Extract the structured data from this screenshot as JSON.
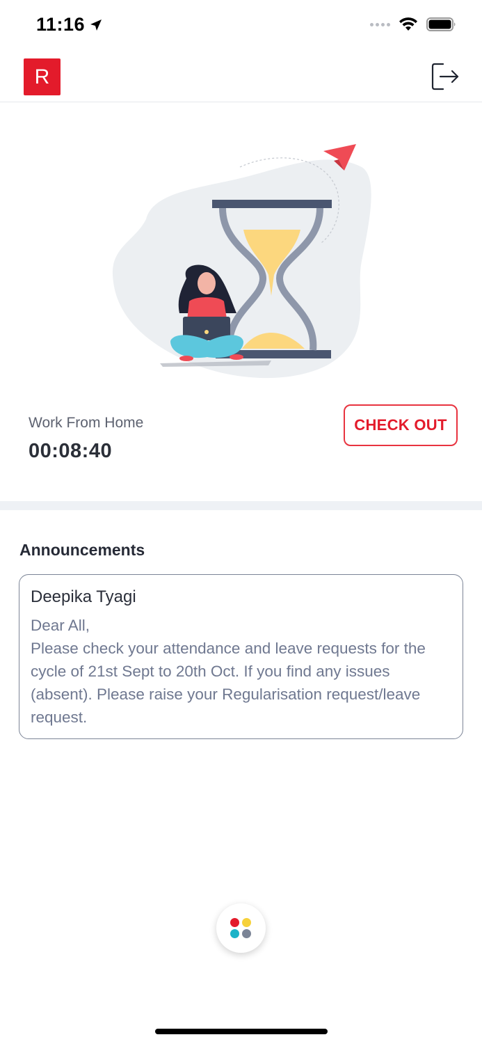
{
  "status_bar": {
    "time": "11:16",
    "icons": [
      "location-arrow-icon",
      "signal-icon",
      "wifi-icon",
      "battery-icon"
    ]
  },
  "header": {
    "logo_letter": "R",
    "logo_color": "#e31b2b",
    "logout_icon": "logout-icon"
  },
  "attendance": {
    "mode_label": "Work From Home",
    "elapsed_time": "00:08:40",
    "action_button_label": "CHECK OUT",
    "accent_color": "#e31b2b"
  },
  "announcements": {
    "title": "Announcements",
    "items": [
      {
        "author": "Deepika Tyagi",
        "message": "Dear All,\nPlease check your attendance and leave requests for the cycle of 21st Sept to 20th Oct. If you find any issues (absent). Please raise your Regularisation request/leave request."
      }
    ]
  },
  "fab": {
    "icon": "app-menu-icon",
    "dot_colors": [
      "#e31b2b",
      "#f6d13a",
      "#1bb3c8",
      "#7b8496"
    ]
  }
}
